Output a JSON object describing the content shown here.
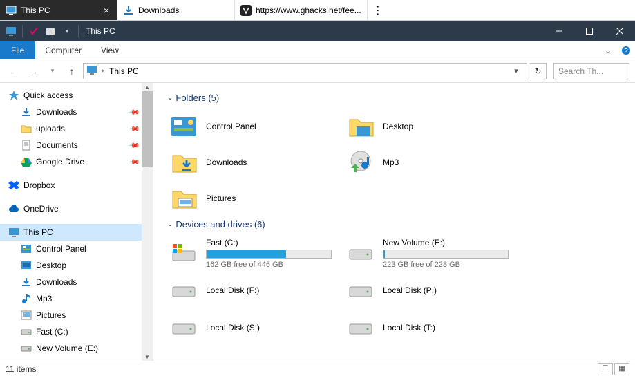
{
  "browser_tabs": [
    {
      "title": "This PC",
      "active": true
    },
    {
      "title": "Downloads",
      "active": false
    },
    {
      "title": "https://www.ghacks.net/fee...",
      "active": false
    }
  ],
  "titlebar": {
    "title": "This PC"
  },
  "ribbon": {
    "file": "File",
    "computer": "Computer",
    "view": "View"
  },
  "breadcrumb": {
    "root": "This PC"
  },
  "search": {
    "placeholder": "Search Th..."
  },
  "sidebar": {
    "quick_access": "Quick access",
    "quick_items": [
      {
        "label": "Downloads"
      },
      {
        "label": "uploads"
      },
      {
        "label": "Documents"
      },
      {
        "label": "Google Drive"
      }
    ],
    "dropbox": "Dropbox",
    "onedrive": "OneDrive",
    "this_pc": "This PC",
    "pc_items": [
      {
        "label": "Control Panel"
      },
      {
        "label": "Desktop"
      },
      {
        "label": "Downloads"
      },
      {
        "label": "Mp3"
      },
      {
        "label": "Pictures"
      },
      {
        "label": "Fast (C:)"
      },
      {
        "label": "New Volume (E:)"
      }
    ]
  },
  "content": {
    "folders_header": "Folders (5)",
    "folders": [
      {
        "name": "Control Panel"
      },
      {
        "name": "Desktop"
      },
      {
        "name": "Downloads"
      },
      {
        "name": "Mp3"
      },
      {
        "name": "Pictures"
      }
    ],
    "drives_header": "Devices and drives (6)",
    "drives": [
      {
        "name": "Fast (C:)",
        "free": "162 GB free of 446 GB",
        "fillpct": 64,
        "os": true
      },
      {
        "name": "New Volume (E:)",
        "free": "223 GB free of 223 GB",
        "fillpct": 1
      },
      {
        "name": "Local Disk (F:)"
      },
      {
        "name": "Local Disk (P:)"
      },
      {
        "name": "Local Disk (S:)"
      },
      {
        "name": "Local Disk (T:)"
      }
    ]
  },
  "statusbar": {
    "count": "11 items"
  }
}
